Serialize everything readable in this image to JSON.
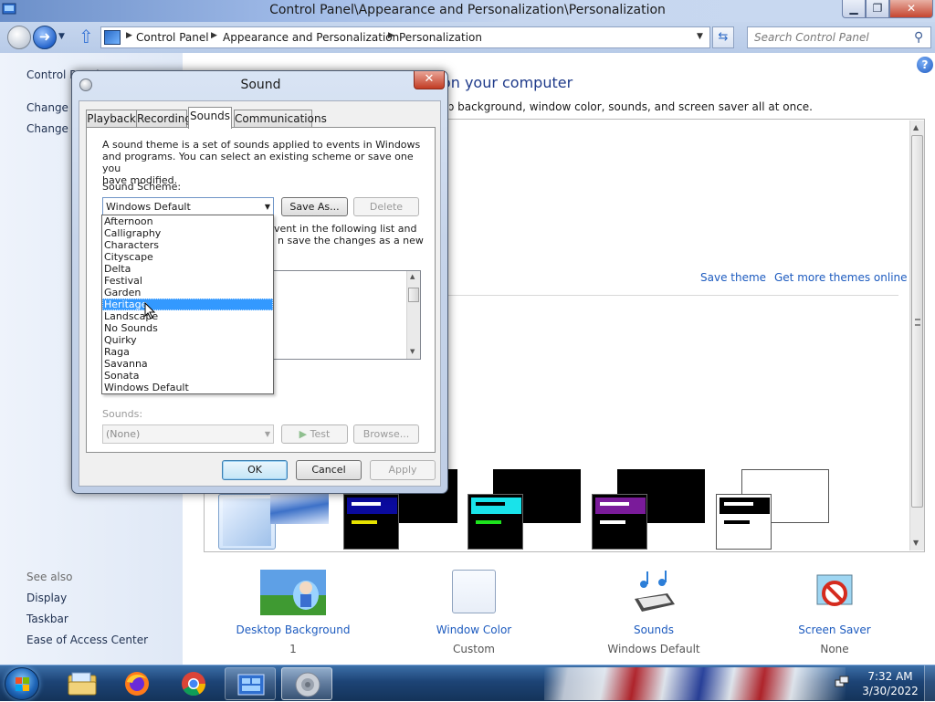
{
  "window": {
    "title": "Control Panel\\Appearance and Personalization\\Personalization",
    "minimize_icon": "minimize-icon",
    "maximize_icon": "restore-icon",
    "close_icon": "close-icon"
  },
  "address_bar": {
    "crumbs": [
      "Control Panel",
      "Appearance and Personalization",
      "Personalization"
    ],
    "search_placeholder": "Search Control Panel"
  },
  "left_pane": {
    "links": [
      "Control Panel Home",
      "Change desktop icons",
      "Change mouse pointers"
    ],
    "see_also_title": "See also",
    "see_also": [
      "Display",
      "Taskbar",
      "Ease of Access Center"
    ]
  },
  "main": {
    "heading": "Change the visuals and sounds on your computer",
    "description": "Click a theme to change the desktop background, window color, sounds, and screen saver all at once.",
    "save_theme": "Save theme",
    "get_more_themes": "Get more themes online"
  },
  "bottom_items": [
    {
      "label": "Desktop Background",
      "sub": "1"
    },
    {
      "label": "Window Color",
      "sub": "Custom"
    },
    {
      "label": "Sounds",
      "sub": "Windows Default"
    },
    {
      "label": "Screen Saver",
      "sub": "None"
    }
  ],
  "dialog": {
    "title": "Sound",
    "tabs": [
      "Playback",
      "Recording",
      "Sounds",
      "Communications"
    ],
    "active_tab": "Sounds",
    "intro_lines": [
      "A sound theme is a set of sounds applied to events in Windows",
      "and programs.  You can select an existing scheme or save one you",
      "have modified."
    ],
    "scheme_label": "Sound Scheme:",
    "scheme_value": "Windows Default",
    "save_as": "Save As...",
    "delete": "Delete",
    "partial_line_1": "vent in the following list and",
    "partial_line_2": "n save the changes as a new",
    "sounds_label": "Sounds:",
    "sounds_value": "(None)",
    "test": "Test",
    "browse": "Browse...",
    "ok": "OK",
    "cancel": "Cancel",
    "apply": "Apply",
    "scheme_options": [
      "Afternoon",
      "Calligraphy",
      "Characters",
      "Cityscape",
      "Delta",
      "Festival",
      "Garden",
      "Heritage",
      "Landscape",
      "No Sounds",
      "Quirky",
      "Raga",
      "Savanna",
      "Sonata",
      "Windows Default"
    ],
    "highlighted_option": "Heritage"
  },
  "taskbar": {
    "time": "7:32 AM",
    "date": "3/30/2022",
    "pinned": [
      "windows-explorer-icon",
      "firefox-icon",
      "chrome-icon",
      "control-panel-icon",
      "sound-icon"
    ]
  },
  "colors": {
    "link": "#1d5bbf",
    "selection": "#3399ff",
    "taskbar": "#1d4476"
  }
}
